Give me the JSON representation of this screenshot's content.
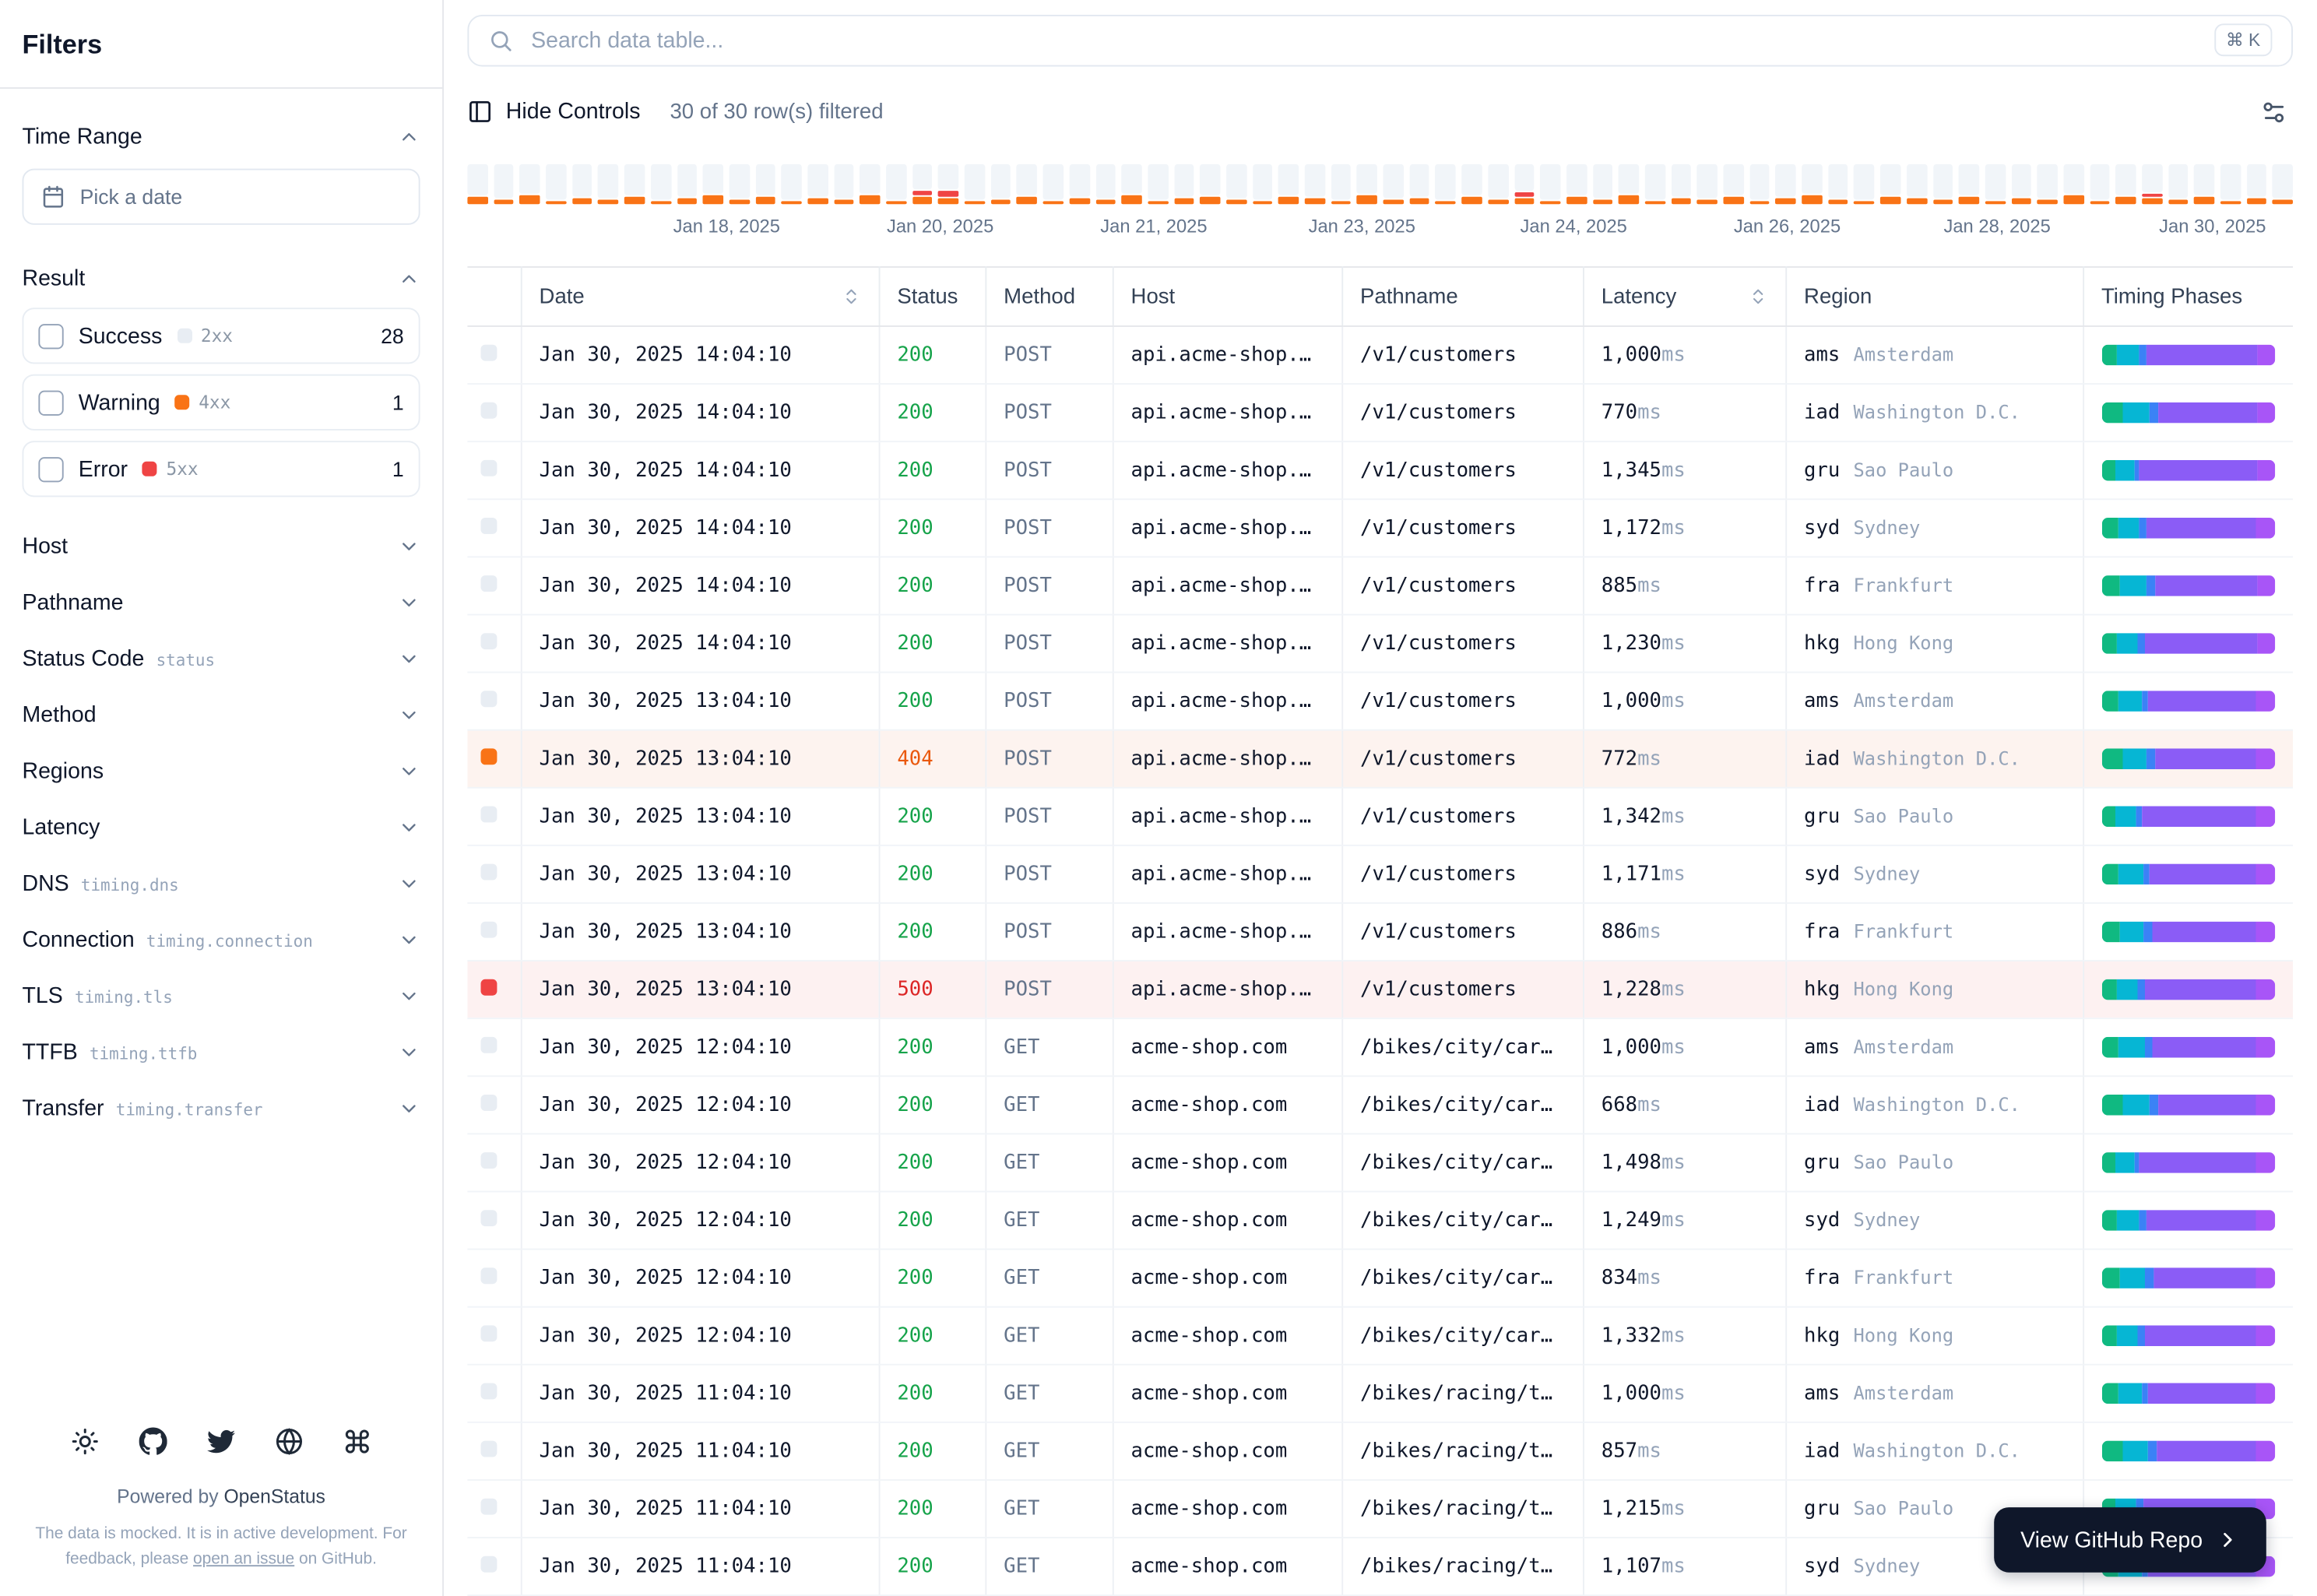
{
  "sidebar": {
    "title": "Filters",
    "time_range": {
      "label": "Time Range",
      "picker_placeholder": "Pick a date"
    },
    "result": {
      "label": "Result",
      "options": [
        {
          "label": "Success",
          "code": "2xx",
          "count": "28",
          "color": "#e8edf3"
        },
        {
          "label": "Warning",
          "code": "4xx",
          "count": "1",
          "color": "#f97316"
        },
        {
          "label": "Error",
          "code": "5xx",
          "count": "1",
          "color": "#ef4444"
        }
      ]
    },
    "sections": [
      {
        "label": "Host"
      },
      {
        "label": "Pathname"
      },
      {
        "label": "Status Code",
        "code": "status"
      },
      {
        "label": "Method"
      },
      {
        "label": "Regions"
      },
      {
        "label": "Latency"
      },
      {
        "label": "DNS",
        "code": "timing.dns"
      },
      {
        "label": "Connection",
        "code": "timing.connection"
      },
      {
        "label": "TLS",
        "code": "timing.tls"
      },
      {
        "label": "TTFB",
        "code": "timing.ttfb"
      },
      {
        "label": "Transfer",
        "code": "timing.transfer"
      }
    ],
    "footer": {
      "powered_prefix": "Powered by ",
      "brand": "OpenStatus",
      "note_prefix": "The data is mocked. It is in active development. For feedback, please ",
      "note_link": "open an issue",
      "note_suffix": " on GitHub."
    }
  },
  "toolbar": {
    "search_placeholder": "Search data table...",
    "kbd": "⌘ K",
    "hide_controls": "Hide Controls",
    "filtered": "30 of 30 row(s) filtered"
  },
  "histogram": {
    "labels": [
      {
        "text": "Jan 18, 2025",
        "pos": 14.2
      },
      {
        "text": "Jan 20, 2025",
        "pos": 25.9
      },
      {
        "text": "Jan 21, 2025",
        "pos": 37.6
      },
      {
        "text": "Jan 23, 2025",
        "pos": 49.0
      },
      {
        "text": "Jan 24, 2025",
        "pos": 60.6
      },
      {
        "text": "Jan 26, 2025",
        "pos": 72.3
      },
      {
        "text": "Jan 28, 2025",
        "pos": 83.8
      },
      {
        "text": "Jan 30, 2025",
        "pos": 95.6
      }
    ],
    "bars": [
      [
        5,
        0
      ],
      [
        3,
        0
      ],
      [
        6,
        0
      ],
      [
        2,
        0
      ],
      [
        4,
        0
      ],
      [
        3,
        0
      ],
      [
        5,
        0
      ],
      [
        2,
        0
      ],
      [
        4,
        0
      ],
      [
        6,
        0
      ],
      [
        3,
        0
      ],
      [
        5,
        0
      ],
      [
        2,
        0
      ],
      [
        4,
        0
      ],
      [
        3,
        0
      ],
      [
        6,
        0
      ],
      [
        2,
        0
      ],
      [
        5,
        3
      ],
      [
        4,
        4
      ],
      [
        2,
        0
      ],
      [
        3,
        0
      ],
      [
        5,
        0
      ],
      [
        2,
        0
      ],
      [
        4,
        0
      ],
      [
        3,
        0
      ],
      [
        6,
        0
      ],
      [
        2,
        0
      ],
      [
        4,
        0
      ],
      [
        5,
        0
      ],
      [
        3,
        0
      ],
      [
        2,
        0
      ],
      [
        5,
        0
      ],
      [
        4,
        0
      ],
      [
        2,
        0
      ],
      [
        6,
        0
      ],
      [
        3,
        0
      ],
      [
        4,
        0
      ],
      [
        2,
        0
      ],
      [
        5,
        0
      ],
      [
        3,
        0
      ],
      [
        4,
        3
      ],
      [
        2,
        0
      ],
      [
        5,
        0
      ],
      [
        3,
        0
      ],
      [
        6,
        0
      ],
      [
        2,
        0
      ],
      [
        4,
        0
      ],
      [
        3,
        0
      ],
      [
        5,
        0
      ],
      [
        2,
        0
      ],
      [
        4,
        0
      ],
      [
        6,
        0
      ],
      [
        3,
        0
      ],
      [
        2,
        0
      ],
      [
        5,
        0
      ],
      [
        4,
        0
      ],
      [
        3,
        0
      ],
      [
        5,
        0
      ],
      [
        2,
        0
      ],
      [
        4,
        0
      ],
      [
        3,
        0
      ],
      [
        6,
        0
      ],
      [
        2,
        0
      ],
      [
        5,
        0
      ],
      [
        4,
        2
      ],
      [
        3,
        0
      ],
      [
        5,
        0
      ],
      [
        2,
        0
      ],
      [
        4,
        0
      ],
      [
        3,
        0
      ]
    ]
  },
  "table": {
    "latency_unit": "ms",
    "columns": [
      {
        "label": "",
        "key": "indicator"
      },
      {
        "label": "Date",
        "sortable": true
      },
      {
        "label": "Status"
      },
      {
        "label": "Method"
      },
      {
        "label": "Host"
      },
      {
        "label": "Pathname"
      },
      {
        "label": "Latency",
        "sortable": true
      },
      {
        "label": "Region"
      },
      {
        "label": "Timing Phases"
      }
    ],
    "rows": [
      {
        "date": "Jan 30, 2025 14:04:10",
        "status": "200",
        "level": "success",
        "method": "POST",
        "host": "api.acme-shop.…",
        "pathname": "/v1/customers",
        "latency": "1,000",
        "region": "ams",
        "city": "Amsterdam",
        "timing": [
          9,
          13,
          4,
          64,
          10
        ]
      },
      {
        "date": "Jan 30, 2025 14:04:10",
        "status": "200",
        "level": "success",
        "method": "POST",
        "host": "api.acme-shop.…",
        "pathname": "/v1/customers",
        "latency": "770",
        "region": "iad",
        "city": "Washington D.C.",
        "timing": [
          12,
          16,
          5,
          57,
          10
        ]
      },
      {
        "date": "Jan 30, 2025 14:04:10",
        "status": "200",
        "level": "success",
        "method": "POST",
        "host": "api.acme-shop.…",
        "pathname": "/v1/customers",
        "latency": "1,345",
        "region": "gru",
        "city": "Sao Paulo",
        "timing": [
          8,
          11,
          3,
          68,
          10
        ]
      },
      {
        "date": "Jan 30, 2025 14:04:10",
        "status": "200",
        "level": "success",
        "method": "POST",
        "host": "api.acme-shop.…",
        "pathname": "/v1/customers",
        "latency": "1,172",
        "region": "syd",
        "city": "Sydney",
        "timing": [
          10,
          12,
          4,
          63,
          11
        ]
      },
      {
        "date": "Jan 30, 2025 14:04:10",
        "status": "200",
        "level": "success",
        "method": "POST",
        "host": "api.acme-shop.…",
        "pathname": "/v1/customers",
        "latency": "885",
        "region": "fra",
        "city": "Frankfurt",
        "timing": [
          11,
          15,
          5,
          59,
          10
        ]
      },
      {
        "date": "Jan 30, 2025 14:04:10",
        "status": "200",
        "level": "success",
        "method": "POST",
        "host": "api.acme-shop.…",
        "pathname": "/v1/customers",
        "latency": "1,230",
        "region": "hkg",
        "city": "Hong Kong",
        "timing": [
          9,
          12,
          4,
          65,
          10
        ]
      },
      {
        "date": "Jan 30, 2025 13:04:10",
        "status": "200",
        "level": "success",
        "method": "POST",
        "host": "api.acme-shop.…",
        "pathname": "/v1/customers",
        "latency": "1,000",
        "region": "ams",
        "city": "Amsterdam",
        "timing": [
          10,
          13,
          4,
          62,
          11
        ]
      },
      {
        "date": "Jan 30, 2025 13:04:10",
        "status": "404",
        "level": "warning",
        "method": "POST",
        "host": "api.acme-shop.…",
        "pathname": "/v1/customers",
        "latency": "772",
        "region": "iad",
        "city": "Washington D.C.",
        "timing": [
          12,
          14,
          5,
          58,
          11
        ]
      },
      {
        "date": "Jan 30, 2025 13:04:10",
        "status": "200",
        "level": "success",
        "method": "POST",
        "host": "api.acme-shop.…",
        "pathname": "/v1/customers",
        "latency": "1,342",
        "region": "gru",
        "city": "Sao Paulo",
        "timing": [
          8,
          12,
          3,
          66,
          11
        ]
      },
      {
        "date": "Jan 30, 2025 13:04:10",
        "status": "200",
        "level": "success",
        "method": "POST",
        "host": "api.acme-shop.…",
        "pathname": "/v1/customers",
        "latency": "1,171",
        "region": "syd",
        "city": "Sydney",
        "timing": [
          10,
          14,
          4,
          61,
          11
        ]
      },
      {
        "date": "Jan 30, 2025 13:04:10",
        "status": "200",
        "level": "success",
        "method": "POST",
        "host": "api.acme-shop.…",
        "pathname": "/v1/customers",
        "latency": "886",
        "region": "fra",
        "city": "Frankfurt",
        "timing": [
          11,
          13,
          5,
          60,
          11
        ]
      },
      {
        "date": "Jan 30, 2025 13:04:10",
        "status": "500",
        "level": "error",
        "method": "POST",
        "host": "api.acme-shop.…",
        "pathname": "/v1/customers",
        "latency": "1,228",
        "region": "hkg",
        "city": "Hong Kong",
        "timing": [
          9,
          12,
          4,
          64,
          11
        ]
      },
      {
        "date": "Jan 30, 2025 12:04:10",
        "status": "200",
        "level": "success",
        "method": "GET",
        "host": "acme-shop.com",
        "pathname": "/bikes/city/car…",
        "latency": "1,000",
        "region": "ams",
        "city": "Amsterdam",
        "timing": [
          10,
          15,
          4,
          60,
          11
        ]
      },
      {
        "date": "Jan 30, 2025 12:04:10",
        "status": "200",
        "level": "success",
        "method": "GET",
        "host": "acme-shop.com",
        "pathname": "/bikes/city/car…",
        "latency": "668",
        "region": "iad",
        "city": "Washington D.C.",
        "timing": [
          12,
          16,
          5,
          56,
          11
        ]
      },
      {
        "date": "Jan 30, 2025 12:04:10",
        "status": "200",
        "level": "success",
        "method": "GET",
        "host": "acme-shop.com",
        "pathname": "/bikes/city/car…",
        "latency": "1,498",
        "region": "gru",
        "city": "Sao Paulo",
        "timing": [
          8,
          11,
          3,
          67,
          11
        ]
      },
      {
        "date": "Jan 30, 2025 12:04:10",
        "status": "200",
        "level": "success",
        "method": "GET",
        "host": "acme-shop.com",
        "pathname": "/bikes/city/car…",
        "latency": "1,249",
        "region": "syd",
        "city": "Sydney",
        "timing": [
          9,
          13,
          4,
          63,
          11
        ]
      },
      {
        "date": "Jan 30, 2025 12:04:10",
        "status": "200",
        "level": "success",
        "method": "GET",
        "host": "acme-shop.com",
        "pathname": "/bikes/city/car…",
        "latency": "834",
        "region": "fra",
        "city": "Frankfurt",
        "timing": [
          11,
          14,
          5,
          59,
          11
        ]
      },
      {
        "date": "Jan 30, 2025 12:04:10",
        "status": "200",
        "level": "success",
        "method": "GET",
        "host": "acme-shop.com",
        "pathname": "/bikes/city/car…",
        "latency": "1,332",
        "region": "hkg",
        "city": "Hong Kong",
        "timing": [
          9,
          12,
          4,
          64,
          11
        ]
      },
      {
        "date": "Jan 30, 2025 11:04:10",
        "status": "200",
        "level": "success",
        "method": "GET",
        "host": "acme-shop.com",
        "pathname": "/bikes/racing/t…",
        "latency": "1,000",
        "region": "ams",
        "city": "Amsterdam",
        "timing": [
          10,
          13,
          4,
          62,
          11
        ]
      },
      {
        "date": "Jan 30, 2025 11:04:10",
        "status": "200",
        "level": "success",
        "method": "GET",
        "host": "acme-shop.com",
        "pathname": "/bikes/racing/t…",
        "latency": "857",
        "region": "iad",
        "city": "Washington D.C.",
        "timing": [
          12,
          15,
          5,
          57,
          11
        ]
      },
      {
        "date": "Jan 30, 2025 11:04:10",
        "status": "200",
        "level": "success",
        "method": "GET",
        "host": "acme-shop.com",
        "pathname": "/bikes/racing/t…",
        "latency": "1,215",
        "region": "gru",
        "city": "Sao Paulo",
        "timing": [
          8,
          12,
          4,
          65,
          11
        ]
      },
      {
        "date": "Jan 30, 2025 11:04:10",
        "status": "200",
        "level": "success",
        "method": "GET",
        "host": "acme-shop.com",
        "pathname": "/bikes/racing/t…",
        "latency": "1,107",
        "region": "syd",
        "city": "Sydney",
        "timing": [
          10,
          13,
          4,
          62,
          11
        ]
      }
    ]
  },
  "github_button": {
    "label": "View GitHub Repo"
  },
  "colors": {
    "status": {
      "success": "#16a34a",
      "warning": "#ea580c",
      "error": "#dc2626"
    },
    "row_bg": {
      "warning": "#fdf3ef",
      "error": "#fdf1f1"
    },
    "indicator": {
      "success": "#e8edf3",
      "warning": "#f97316",
      "error": "#ef4444"
    },
    "timing_phases": [
      "#10b981",
      "#06b6d4",
      "#3b82f6",
      "#8b5cf6",
      "#a855f7"
    ],
    "histogram": {
      "bar": "#f1f5f9",
      "orange": "#f97316",
      "red": "#ef4444"
    }
  }
}
